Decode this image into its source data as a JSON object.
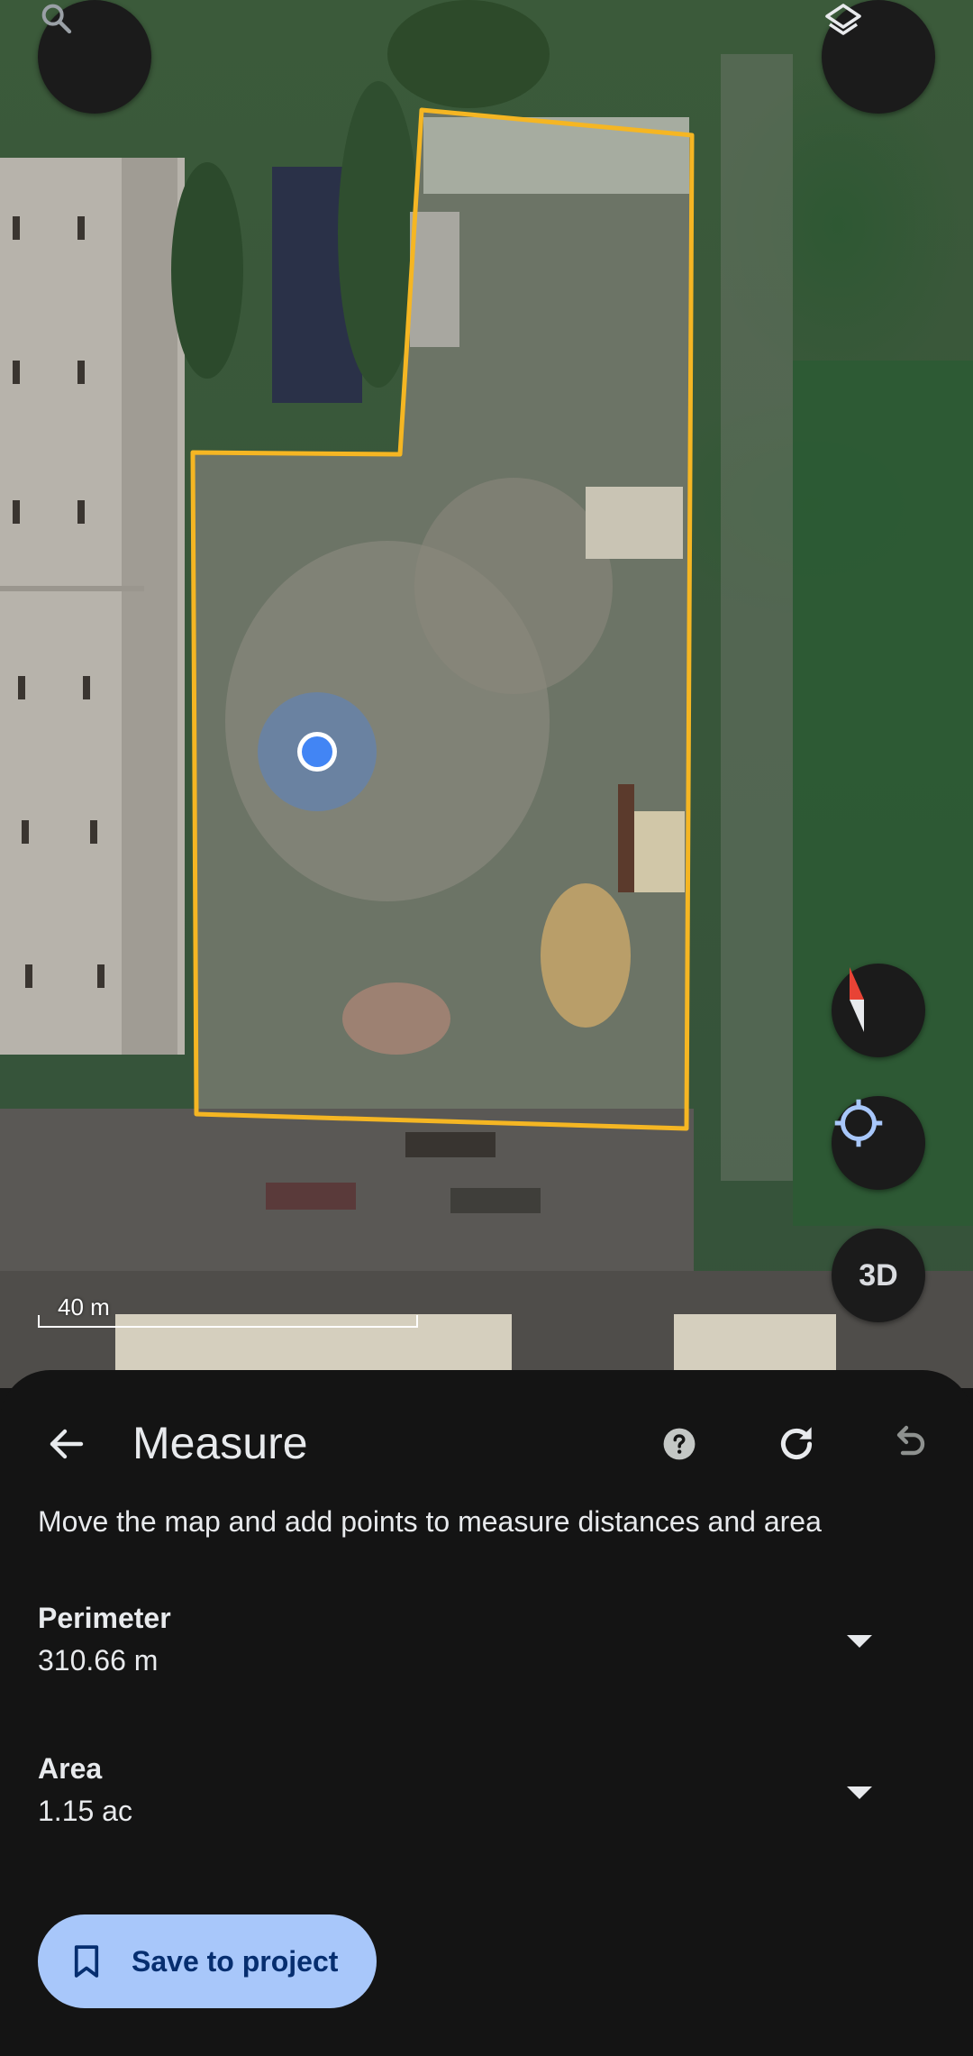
{
  "map": {
    "scale_label": "40 m",
    "buttons": {
      "search_icon": "search-icon",
      "layers_icon": "layers-icon",
      "compass_icon": "compass-icon",
      "locate_icon": "my-location-icon",
      "view_3d_label": "3D"
    },
    "colors": {
      "boundary": "#f5b623",
      "location_dot": "#4285f4"
    }
  },
  "measure": {
    "title": "Measure",
    "instructions": "Move the map and add points to measure distances and area",
    "perimeter": {
      "label": "Perimeter",
      "value": "310.66 m"
    },
    "area": {
      "label": "Area",
      "value": "1.15 ac"
    },
    "save_button_label": "Save to project",
    "icons": {
      "back": "arrow-back-icon",
      "help": "help-icon",
      "reset": "refresh-icon",
      "undo": "undo-icon",
      "dropdown": "caret-down-icon",
      "bookmark": "bookmark-icon"
    },
    "colors": {
      "sheet_background": "#141414",
      "save_button_bg": "#a8c7fa",
      "save_button_text": "#062e6f"
    }
  }
}
